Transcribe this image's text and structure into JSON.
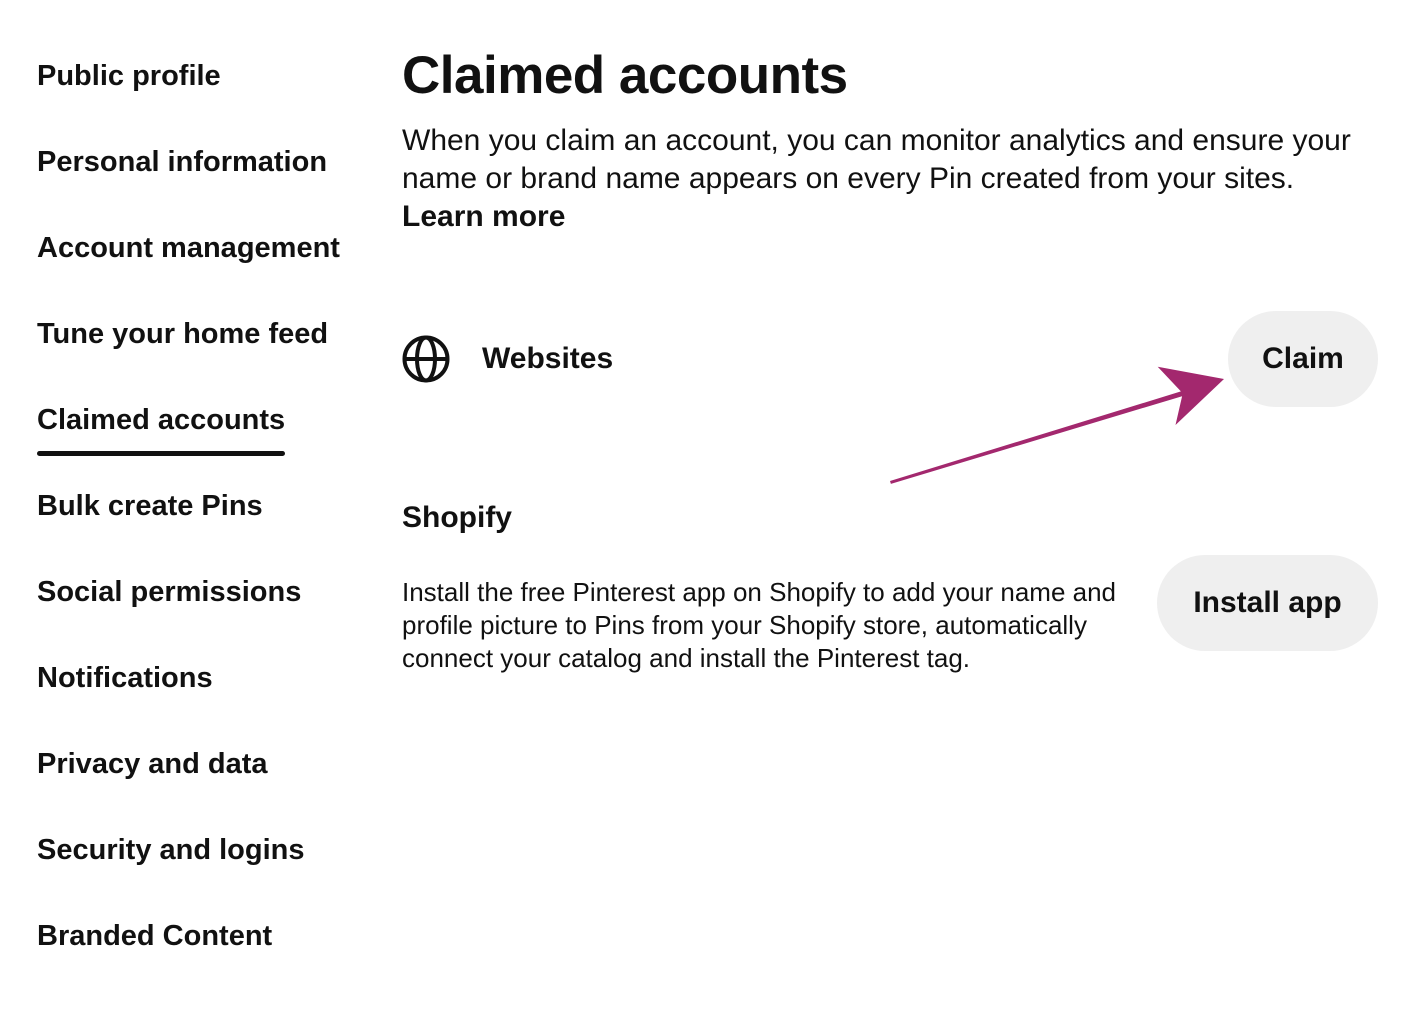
{
  "sidebar": {
    "items": [
      {
        "label": "Public profile"
      },
      {
        "label": "Personal information"
      },
      {
        "label": "Account management"
      },
      {
        "label": "Tune your home feed"
      },
      {
        "label": "Claimed accounts",
        "active": true
      },
      {
        "label": "Bulk create Pins"
      },
      {
        "label": "Social permissions"
      },
      {
        "label": "Notifications"
      },
      {
        "label": "Privacy and data"
      },
      {
        "label": "Security and logins"
      },
      {
        "label": "Branded Content"
      }
    ]
  },
  "main": {
    "title": "Claimed accounts",
    "description": "When you claim an account, you can monitor analytics and ensure your name or brand name appears on every Pin created from your sites.",
    "learn_more": "Learn more",
    "websites": {
      "icon": "globe-icon",
      "label": "Websites",
      "button_label": "Claim"
    },
    "shopify": {
      "title": "Shopify",
      "description": "Install the free Pinterest app on Shopify to add your name and profile picture to Pins from your Shopify store, automatically connect your catalog and install the Pinterest tag.",
      "button_label": "Install app"
    }
  },
  "annotation": {
    "arrow_color": "#a3286e"
  },
  "colors": {
    "text": "#111111",
    "pill_bg": "#efefef",
    "background": "#ffffff"
  }
}
